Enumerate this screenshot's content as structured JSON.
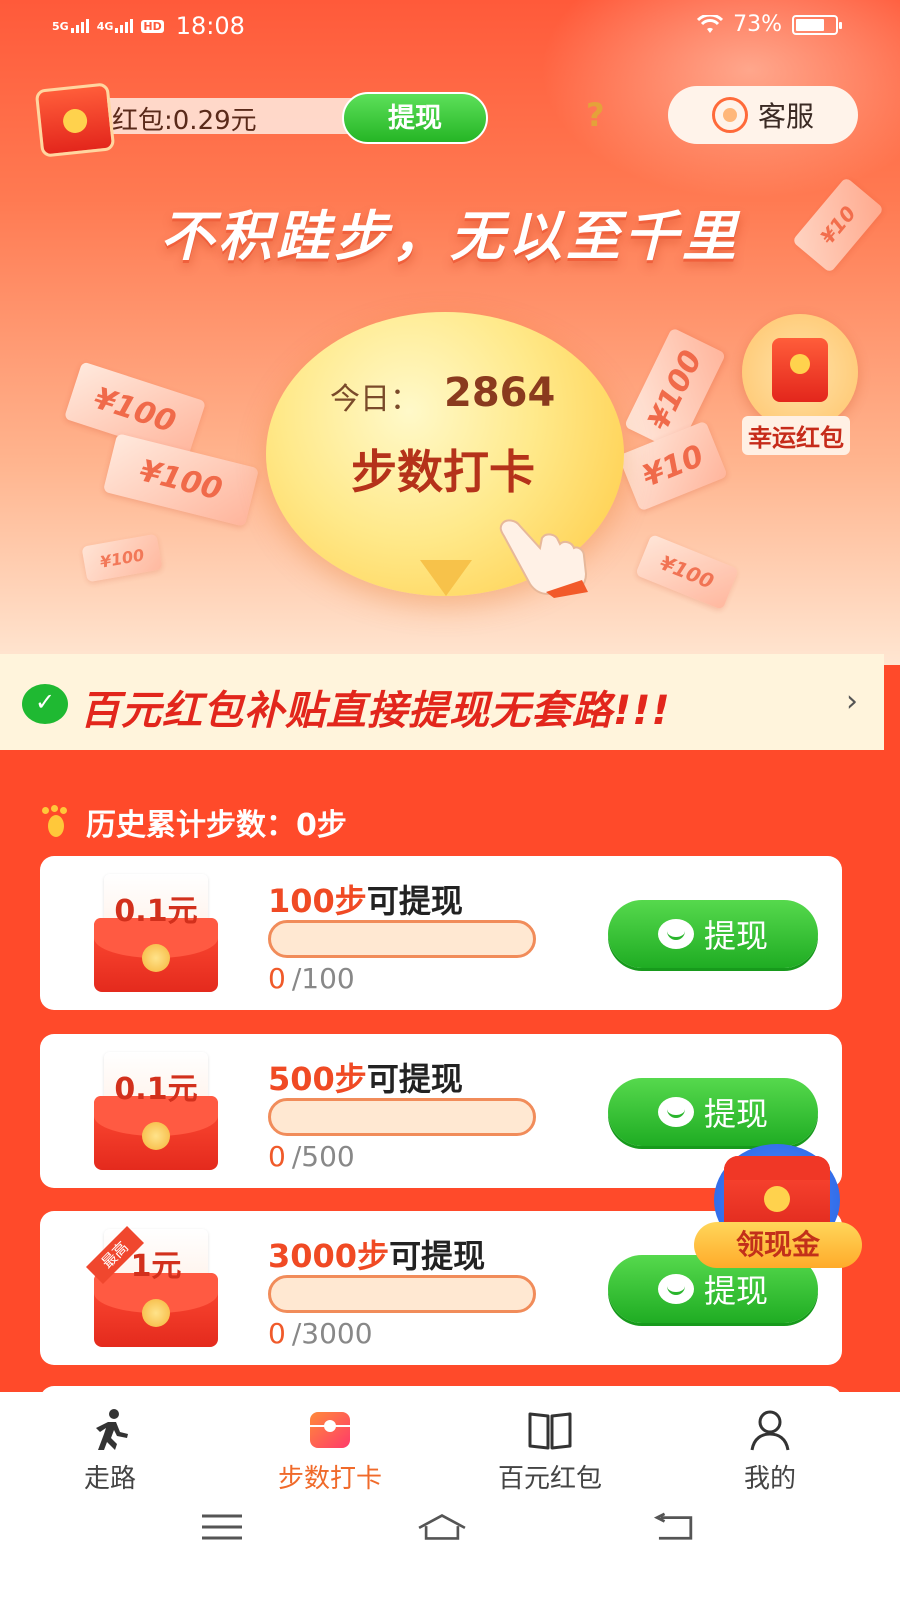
{
  "status": {
    "net1": "5G",
    "net2": "4G",
    "hd": "HD",
    "time": "18:08",
    "battery": "73%",
    "battery_level": 0.73
  },
  "header": {
    "balance": "红包:0.29元",
    "withdraw_label": "提现",
    "help": "?",
    "service_label": "客服"
  },
  "hero": {
    "slogan": "不积跬步，无以至千里",
    "today_label": "今日：",
    "today_steps": "2864",
    "checkin_label": "步数打卡",
    "lucky_label": "幸运红包",
    "bills": [
      "¥100",
      "¥100",
      "¥100",
      "¥100",
      "¥10",
      "¥100",
      "¥10"
    ]
  },
  "banner": {
    "text": "百元红包补贴直接提现无套路!!!",
    "arrow": "›"
  },
  "history": {
    "label": "历史累计步数：0步"
  },
  "tasks": [
    {
      "amount": "0.1元",
      "goal_num": "100步",
      "goal_suffix": "可提现",
      "current": "0",
      "total": "/100",
      "progress": 0,
      "withdraw": "提现"
    },
    {
      "amount": "0.1元",
      "goal_num": "500步",
      "goal_suffix": "可提现",
      "current": "0",
      "total": "/500",
      "progress": 0,
      "withdraw": "提现"
    },
    {
      "amount": "1元",
      "ribbon": "最高",
      "goal_num": "3000步",
      "goal_suffix": "可提现",
      "current": "0",
      "total": "/3000",
      "progress": 0,
      "withdraw": "提现"
    }
  ],
  "floating": {
    "label": "领现金"
  },
  "tabs": [
    {
      "label": "走路",
      "icon": "walk-icon",
      "active": false
    },
    {
      "label": "步数打卡",
      "icon": "wallet-icon",
      "active": true
    },
    {
      "label": "百元红包",
      "icon": "book-icon",
      "active": false
    },
    {
      "label": "我的",
      "icon": "person-icon",
      "active": false
    }
  ],
  "colors": {
    "accent": "#ff4a2a",
    "active_tab": "#f06a2a",
    "green_button": "#25b525"
  }
}
